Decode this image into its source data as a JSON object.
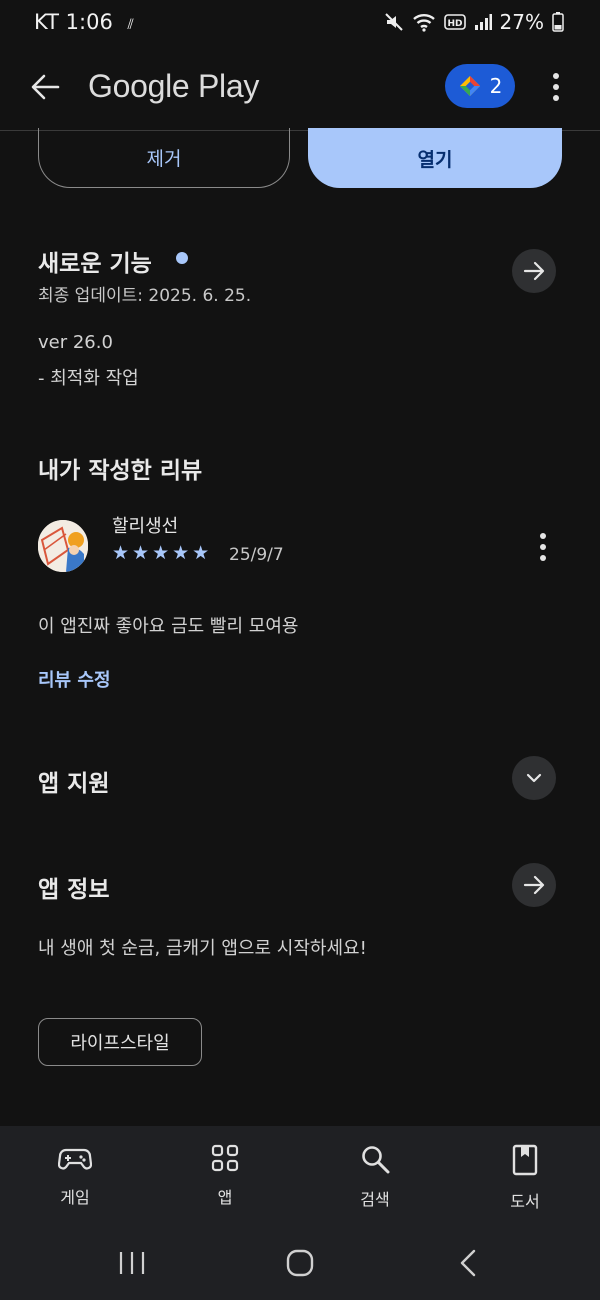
{
  "status_bar": {
    "carrier_time": "KT 1:06",
    "battery": "27%"
  },
  "app_bar": {
    "title": "Google Play",
    "badge_count": "2"
  },
  "actions": {
    "remove_label": "제거",
    "open_label": "열기"
  },
  "whats_new": {
    "title": "새로운 기능",
    "updated": "최종 업데이트: 2025. 6. 25.",
    "version": "ver 26.0",
    "note": "- 최적화 작업"
  },
  "my_review": {
    "title": "내가 작성한 리뷰",
    "author": "할리생선",
    "stars": "★★★★★",
    "date": "25/9/7",
    "text": "이 앱진짜 좋아요 금도 빨리 모여용",
    "edit_label": "리뷰 수정"
  },
  "app_support": {
    "title": "앱 지원"
  },
  "app_info": {
    "title": "앱 정보",
    "description": "내 생애 첫 순금, 금캐기 앱으로 시작하세요!",
    "category_chip": "라이프스타일"
  },
  "bottom_nav": {
    "games": "게임",
    "apps": "앱",
    "search": "검색",
    "books": "도서"
  },
  "colors": {
    "accent": "#a8c7fa",
    "background": "#121212",
    "badge": "#1d5bd6"
  }
}
